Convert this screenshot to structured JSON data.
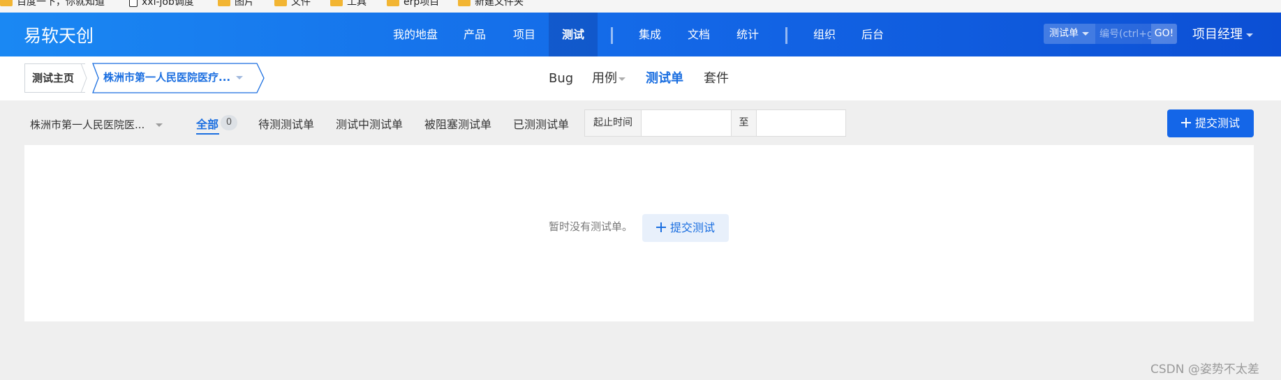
{
  "bookmarks": [
    {
      "icon": "folder-icon",
      "label": "百度一下，你就知道"
    },
    {
      "icon": "page-icon",
      "label": "xxl-job调度"
    },
    {
      "icon": "folder-icon",
      "label": "图片"
    },
    {
      "icon": "folder-icon",
      "label": "文件"
    },
    {
      "icon": "folder-icon",
      "label": "工具"
    },
    {
      "icon": "folder-icon",
      "label": "erp项目"
    },
    {
      "icon": "folder-icon",
      "label": "新建文件夹"
    }
  ],
  "header": {
    "logo": "易软天创",
    "nav": [
      "我的地盘",
      "产品",
      "项目",
      "测试",
      "集成",
      "文档",
      "统计",
      "组织",
      "后台"
    ],
    "active_nav": "测试",
    "search": {
      "type": "测试单",
      "placeholder": "编号(ctrl+g)",
      "go": "GO!"
    },
    "user": "项目经理"
  },
  "subnav": {
    "breadcrumb_home": "测试主页",
    "breadcrumb_project": "株洲市第一人民医院医疗...",
    "items": [
      "Bug",
      "用例",
      "测试单",
      "套件"
    ],
    "active": "测试单"
  },
  "filter": {
    "product": "株洲市第一人民医院医...",
    "tabs": [
      "全部",
      "待测测试单",
      "测试中测试单",
      "被阻塞测试单",
      "已测测试单"
    ],
    "all_count": "0",
    "date_from_label": "起止时间",
    "date_to_label": "至",
    "date_from": "",
    "date_to": "",
    "submit": "提交测试"
  },
  "main": {
    "empty_text": "暂时没有测试单。",
    "empty_action": "提交测试"
  },
  "watermark": "CSDN @姿势不太差",
  "colors": {
    "primary": "#1466e8",
    "header_start": "#1a88f3",
    "header_end": "#0c4fd4",
    "link": "#1a6ee0"
  }
}
